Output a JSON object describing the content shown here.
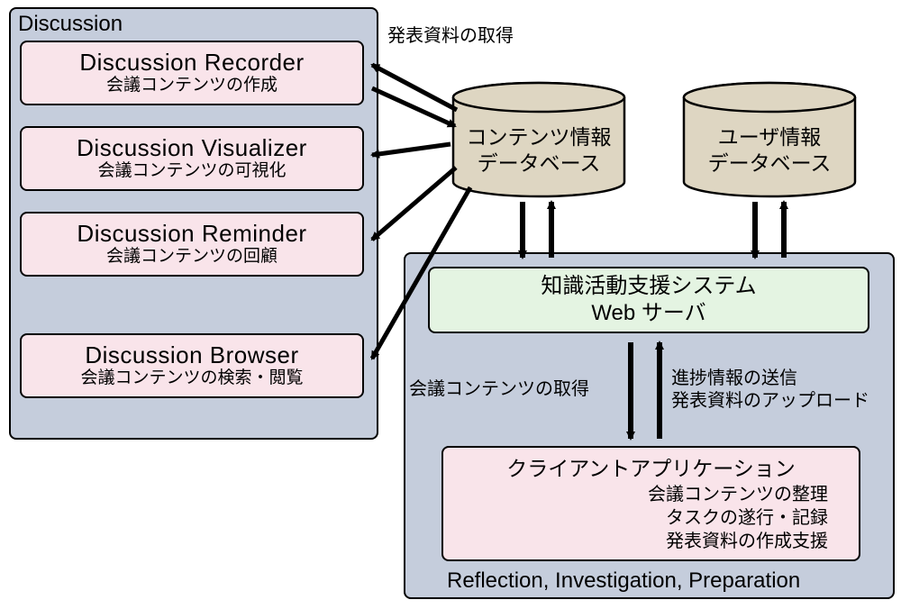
{
  "discussion": {
    "title": "Discussion",
    "boxes": {
      "recorder": {
        "en": "Discussion Recorder",
        "jp": "会議コンテンツの作成"
      },
      "visualizer": {
        "en": "Discussion Visualizer",
        "jp": "会議コンテンツの可視化"
      },
      "reminder": {
        "en": "Discussion Reminder",
        "jp": "会議コンテンツの回顧"
      },
      "browser": {
        "en": "Discussion Browser",
        "jp": "会議コンテンツの検索・閲覧"
      }
    }
  },
  "right": {
    "title": "Reflection, Investigation, Preparation",
    "server": {
      "line1": "知識活動支援システム",
      "line2": "Web サーバ"
    },
    "client": {
      "title": "クライアントアプリケーション",
      "sub1": "会議コンテンツの整理",
      "sub2": "タスクの遂行・記録",
      "sub3": "発表資料の作成支援"
    }
  },
  "databases": {
    "content": {
      "line1": "コンテンツ情報",
      "line2": "データベース"
    },
    "user": {
      "line1": "ユーザ情報",
      "line2": "データベース"
    }
  },
  "annotations": {
    "fetch_presentation": "発表資料の取得",
    "get_meeting_content": "会議コンテンツの取得",
    "send_progress_line1": "進捗情報の送信",
    "send_progress_line2": "発表資料のアップロード"
  }
}
